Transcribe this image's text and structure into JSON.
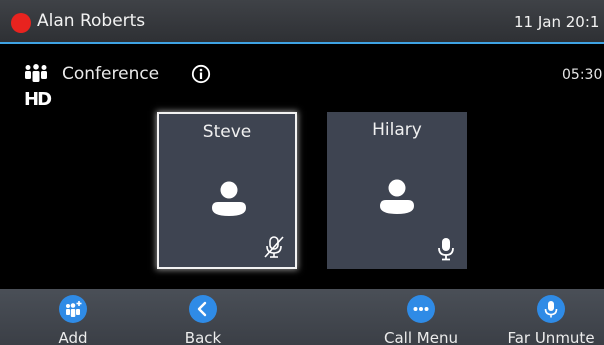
{
  "status_bar": {
    "user_name": "Alan Roberts",
    "datetime": "11 Jan 20:1",
    "status_color": "#e8231f"
  },
  "call": {
    "title": "Conference",
    "duration": "05:30",
    "icons": [
      "conference-icon",
      "info-icon",
      "hd-icon"
    ]
  },
  "participants": [
    {
      "name": "Steve",
      "selected": true,
      "mic_state": "muted",
      "mic_icon": "mic-muted-icon"
    },
    {
      "name": "Hilary",
      "selected": false,
      "mic_state": "unmuted",
      "mic_icon": "mic-icon"
    }
  ],
  "softkeys": [
    {
      "label": "Add",
      "icon": "add-participant-icon"
    },
    {
      "label": "Back",
      "icon": "chevron-left-icon"
    },
    {
      "label": "Call Menu",
      "icon": "more-dots-icon"
    },
    {
      "label": "Far Unmute",
      "icon": "mic-icon"
    }
  ],
  "colors": {
    "accent": "#2f8be6",
    "tile": "#3e4451",
    "status_line": "#3fa3e3"
  }
}
